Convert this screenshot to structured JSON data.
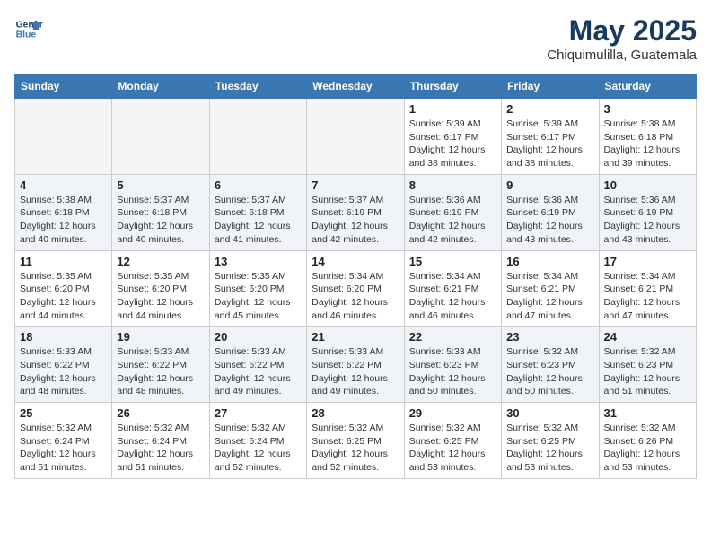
{
  "logo": {
    "line1": "General",
    "line2": "Blue"
  },
  "title": "May 2025",
  "subtitle": "Chiquimulilla, Guatemala",
  "weekdays": [
    "Sunday",
    "Monday",
    "Tuesday",
    "Wednesday",
    "Thursday",
    "Friday",
    "Saturday"
  ],
  "weeks": [
    [
      {
        "day": "",
        "info": ""
      },
      {
        "day": "",
        "info": ""
      },
      {
        "day": "",
        "info": ""
      },
      {
        "day": "",
        "info": ""
      },
      {
        "day": "1",
        "info": "Sunrise: 5:39 AM\nSunset: 6:17 PM\nDaylight: 12 hours\nand 38 minutes."
      },
      {
        "day": "2",
        "info": "Sunrise: 5:39 AM\nSunset: 6:17 PM\nDaylight: 12 hours\nand 38 minutes."
      },
      {
        "day": "3",
        "info": "Sunrise: 5:38 AM\nSunset: 6:18 PM\nDaylight: 12 hours\nand 39 minutes."
      }
    ],
    [
      {
        "day": "4",
        "info": "Sunrise: 5:38 AM\nSunset: 6:18 PM\nDaylight: 12 hours\nand 40 minutes."
      },
      {
        "day": "5",
        "info": "Sunrise: 5:37 AM\nSunset: 6:18 PM\nDaylight: 12 hours\nand 40 minutes."
      },
      {
        "day": "6",
        "info": "Sunrise: 5:37 AM\nSunset: 6:18 PM\nDaylight: 12 hours\nand 41 minutes."
      },
      {
        "day": "7",
        "info": "Sunrise: 5:37 AM\nSunset: 6:19 PM\nDaylight: 12 hours\nand 42 minutes."
      },
      {
        "day": "8",
        "info": "Sunrise: 5:36 AM\nSunset: 6:19 PM\nDaylight: 12 hours\nand 42 minutes."
      },
      {
        "day": "9",
        "info": "Sunrise: 5:36 AM\nSunset: 6:19 PM\nDaylight: 12 hours\nand 43 minutes."
      },
      {
        "day": "10",
        "info": "Sunrise: 5:36 AM\nSunset: 6:19 PM\nDaylight: 12 hours\nand 43 minutes."
      }
    ],
    [
      {
        "day": "11",
        "info": "Sunrise: 5:35 AM\nSunset: 6:20 PM\nDaylight: 12 hours\nand 44 minutes."
      },
      {
        "day": "12",
        "info": "Sunrise: 5:35 AM\nSunset: 6:20 PM\nDaylight: 12 hours\nand 44 minutes."
      },
      {
        "day": "13",
        "info": "Sunrise: 5:35 AM\nSunset: 6:20 PM\nDaylight: 12 hours\nand 45 minutes."
      },
      {
        "day": "14",
        "info": "Sunrise: 5:34 AM\nSunset: 6:20 PM\nDaylight: 12 hours\nand 46 minutes."
      },
      {
        "day": "15",
        "info": "Sunrise: 5:34 AM\nSunset: 6:21 PM\nDaylight: 12 hours\nand 46 minutes."
      },
      {
        "day": "16",
        "info": "Sunrise: 5:34 AM\nSunset: 6:21 PM\nDaylight: 12 hours\nand 47 minutes."
      },
      {
        "day": "17",
        "info": "Sunrise: 5:34 AM\nSunset: 6:21 PM\nDaylight: 12 hours\nand 47 minutes."
      }
    ],
    [
      {
        "day": "18",
        "info": "Sunrise: 5:33 AM\nSunset: 6:22 PM\nDaylight: 12 hours\nand 48 minutes."
      },
      {
        "day": "19",
        "info": "Sunrise: 5:33 AM\nSunset: 6:22 PM\nDaylight: 12 hours\nand 48 minutes."
      },
      {
        "day": "20",
        "info": "Sunrise: 5:33 AM\nSunset: 6:22 PM\nDaylight: 12 hours\nand 49 minutes."
      },
      {
        "day": "21",
        "info": "Sunrise: 5:33 AM\nSunset: 6:22 PM\nDaylight: 12 hours\nand 49 minutes."
      },
      {
        "day": "22",
        "info": "Sunrise: 5:33 AM\nSunset: 6:23 PM\nDaylight: 12 hours\nand 50 minutes."
      },
      {
        "day": "23",
        "info": "Sunrise: 5:32 AM\nSunset: 6:23 PM\nDaylight: 12 hours\nand 50 minutes."
      },
      {
        "day": "24",
        "info": "Sunrise: 5:32 AM\nSunset: 6:23 PM\nDaylight: 12 hours\nand 51 minutes."
      }
    ],
    [
      {
        "day": "25",
        "info": "Sunrise: 5:32 AM\nSunset: 6:24 PM\nDaylight: 12 hours\nand 51 minutes."
      },
      {
        "day": "26",
        "info": "Sunrise: 5:32 AM\nSunset: 6:24 PM\nDaylight: 12 hours\nand 51 minutes."
      },
      {
        "day": "27",
        "info": "Sunrise: 5:32 AM\nSunset: 6:24 PM\nDaylight: 12 hours\nand 52 minutes."
      },
      {
        "day": "28",
        "info": "Sunrise: 5:32 AM\nSunset: 6:25 PM\nDaylight: 12 hours\nand 52 minutes."
      },
      {
        "day": "29",
        "info": "Sunrise: 5:32 AM\nSunset: 6:25 PM\nDaylight: 12 hours\nand 53 minutes."
      },
      {
        "day": "30",
        "info": "Sunrise: 5:32 AM\nSunset: 6:25 PM\nDaylight: 12 hours\nand 53 minutes."
      },
      {
        "day": "31",
        "info": "Sunrise: 5:32 AM\nSunset: 6:26 PM\nDaylight: 12 hours\nand 53 minutes."
      }
    ]
  ]
}
